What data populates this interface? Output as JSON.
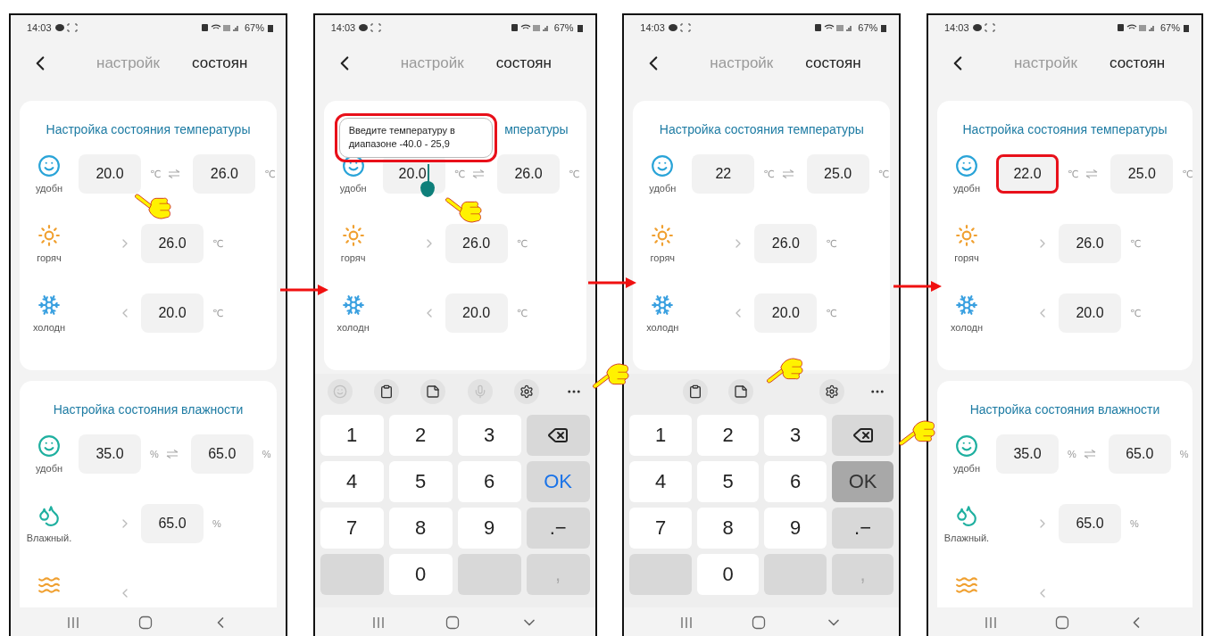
{
  "phones": [
    {
      "status": {
        "time": "14:03",
        "battery": "67%"
      },
      "tabs": [
        {
          "label": "настройк",
          "selected": false
        },
        {
          "label": "состоян",
          "selected": true
        }
      ],
      "cards": [
        {
          "kind": "temperature",
          "title": "Настройка состояния температуры",
          "rows": [
            {
              "kind": "range",
              "label": "удобн",
              "fields": [
                {
                  "value": "20.0",
                  "unit": "℃",
                  "focused": false,
                  "marked": false
                },
                {
                  "value": "26.0",
                  "unit": "℃",
                  "focused": false,
                  "marked": false
                }
              ]
            },
            {
              "kind": "above",
              "label": "горяч",
              "fields": [
                {
                  "value": "26.0",
                  "unit": "℃",
                  "focused": false,
                  "marked": false
                }
              ]
            },
            {
              "kind": "below",
              "label": "холодн",
              "fields": [
                {
                  "value": "20.0",
                  "unit": "℃",
                  "focused": false,
                  "marked": false
                }
              ]
            }
          ]
        },
        {
          "kind": "humidity",
          "title": "Настройка состояния влажности",
          "rows": [
            {
              "kind": "range",
              "label": "удобн",
              "fields": [
                {
                  "value": "35.0",
                  "unit": "%",
                  "focused": false,
                  "marked": false
                },
                {
                  "value": "65.0",
                  "unit": "%",
                  "focused": false,
                  "marked": false
                }
              ]
            },
            {
              "kind": "above",
              "label": "Влажный.",
              "fields": [
                {
                  "value": "65.0",
                  "unit": "%",
                  "focused": false,
                  "marked": false
                }
              ]
            },
            {
              "kind": "below"
            }
          ]
        }
      ]
    },
    {
      "status": {
        "time": "14:03",
        "battery": "67%"
      },
      "tabs": [
        {
          "label": "настройк",
          "selected": false
        },
        {
          "label": "состоян",
          "selected": true
        }
      ],
      "tooltip": {
        "text": "Введите температуру в диапазоне -40.0 - 25,9",
        "marked": true
      },
      "cards": [
        {
          "kind": "temperature",
          "title": "мпературы",
          "rows": [
            {
              "kind": "range",
              "label": "удобн",
              "fields": [
                {
                  "value": "20.0",
                  "unit": "℃",
                  "focused": true,
                  "marked": false
                },
                {
                  "value": "26.0",
                  "unit": "℃",
                  "focused": false,
                  "marked": false
                }
              ]
            },
            {
              "kind": "above",
              "label": "горяч",
              "fields": [
                {
                  "value": "26.0",
                  "unit": "℃",
                  "focused": false,
                  "marked": false
                }
              ]
            },
            {
              "kind": "below",
              "label": "холодн",
              "fields": [
                {
                  "value": "20.0",
                  "unit": "℃",
                  "focused": false,
                  "marked": false
                }
              ]
            }
          ]
        }
      ],
      "keyboard": {
        "keys": [
          {
            "kind": "digit",
            "label": "1",
            "pressed": false
          },
          {
            "kind": "digit",
            "label": "2",
            "pressed": false
          },
          {
            "kind": "digit",
            "label": "3",
            "pressed": false
          },
          {
            "kind": "backspace",
            "pressed": false
          },
          {
            "kind": "digit",
            "label": "4",
            "pressed": false
          },
          {
            "kind": "digit",
            "label": "5",
            "pressed": false
          },
          {
            "kind": "digit",
            "label": "6",
            "pressed": false
          },
          {
            "kind": "action",
            "label": "OK",
            "pressed": false
          },
          {
            "kind": "digit",
            "label": "7",
            "pressed": false
          },
          {
            "kind": "digit",
            "label": "8",
            "pressed": false
          },
          {
            "kind": "digit",
            "label": "9",
            "pressed": false
          },
          {
            "kind": "symbol",
            "label": ".−",
            "pressed": false
          },
          {
            "kind": "blank",
            "pressed": false
          },
          {
            "kind": "digit",
            "label": "0",
            "pressed": false
          },
          {
            "kind": "blank",
            "pressed": false
          },
          {
            "kind": "symbol",
            "label": ",",
            "pressed": false
          }
        ]
      }
    },
    {
      "status": {
        "time": "14:03",
        "battery": "67%"
      },
      "tabs": [
        {
          "label": "настройк",
          "selected": false
        },
        {
          "label": "состоян",
          "selected": true
        }
      ],
      "cards": [
        {
          "kind": "temperature",
          "title": "Настройка состояния температуры",
          "rows": [
            {
              "kind": "range",
              "label": "удобн",
              "fields": [
                {
                  "value": "22",
                  "unit": "℃",
                  "focused": false,
                  "marked": false
                },
                {
                  "value": "25.0",
                  "unit": "℃",
                  "focused": false,
                  "marked": false
                }
              ]
            },
            {
              "kind": "above",
              "label": "горяч",
              "fields": [
                {
                  "value": "26.0",
                  "unit": "℃",
                  "focused": false,
                  "marked": false
                }
              ]
            },
            {
              "kind": "below",
              "label": "холодн",
              "fields": [
                {
                  "value": "20.0",
                  "unit": "℃",
                  "focused": false,
                  "marked": false
                }
              ]
            }
          ]
        }
      ],
      "keyboard": {
        "keys": [
          {
            "kind": "digit",
            "label": "1",
            "pressed": false
          },
          {
            "kind": "digit",
            "label": "2",
            "pressed": false
          },
          {
            "kind": "digit",
            "label": "3",
            "pressed": false
          },
          {
            "kind": "backspace",
            "pressed": false
          },
          {
            "kind": "digit",
            "label": "4",
            "pressed": false
          },
          {
            "kind": "digit",
            "label": "5",
            "pressed": false
          },
          {
            "kind": "digit",
            "label": "6",
            "pressed": false
          },
          {
            "kind": "action",
            "label": "OK",
            "pressed": true
          },
          {
            "kind": "digit",
            "label": "7",
            "pressed": false
          },
          {
            "kind": "digit",
            "label": "8",
            "pressed": false
          },
          {
            "kind": "digit",
            "label": "9",
            "pressed": false
          },
          {
            "kind": "symbol",
            "label": ".−",
            "pressed": false
          },
          {
            "kind": "blank",
            "pressed": false
          },
          {
            "kind": "digit",
            "label": "0",
            "pressed": false
          },
          {
            "kind": "blank",
            "pressed": false
          },
          {
            "kind": "symbol",
            "label": ",",
            "pressed": false
          }
        ]
      }
    },
    {
      "status": {
        "time": "14:03",
        "battery": "67%"
      },
      "tabs": [
        {
          "label": "настройк",
          "selected": false
        },
        {
          "label": "состоян",
          "selected": true
        }
      ],
      "cards": [
        {
          "kind": "temperature",
          "title": "Настройка состояния температуры",
          "rows": [
            {
              "kind": "range",
              "label": "удобн",
              "fields": [
                {
                  "value": "22.0",
                  "unit": "℃",
                  "focused": false,
                  "marked": true
                },
                {
                  "value": "25.0",
                  "unit": "℃",
                  "focused": false,
                  "marked": false
                }
              ]
            },
            {
              "kind": "above",
              "label": "горяч",
              "fields": [
                {
                  "value": "26.0",
                  "unit": "℃",
                  "focused": false,
                  "marked": false
                }
              ]
            },
            {
              "kind": "below",
              "label": "холодн",
              "fields": [
                {
                  "value": "20.0",
                  "unit": "℃",
                  "focused": false,
                  "marked": false
                }
              ]
            }
          ]
        },
        {
          "kind": "humidity",
          "title": "Настройка состояния влажности",
          "rows": [
            {
              "kind": "range",
              "label": "удобн",
              "fields": [
                {
                  "value": "35.0",
                  "unit": "%",
                  "focused": false,
                  "marked": false
                },
                {
                  "value": "65.0",
                  "unit": "%",
                  "focused": false,
                  "marked": false
                }
              ]
            },
            {
              "kind": "above",
              "label": "Влажный.",
              "fields": [
                {
                  "value": "65.0",
                  "unit": "%",
                  "focused": false,
                  "marked": false
                }
              ]
            },
            {
              "kind": "below"
            }
          ]
        }
      ]
    }
  ]
}
